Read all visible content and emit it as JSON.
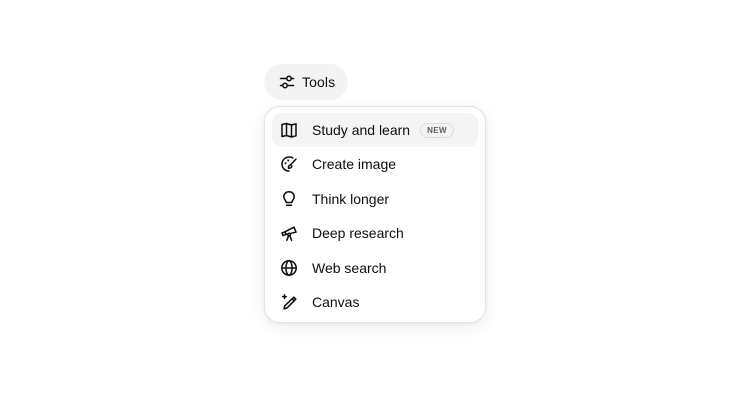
{
  "tools_button": {
    "label": "Tools",
    "icon": "sliders-icon"
  },
  "menu": {
    "items": [
      {
        "label": "Study and learn",
        "icon": "open-book-icon",
        "badge": "NEW",
        "highlighted": true
      },
      {
        "label": "Create image",
        "icon": "palette-brush-icon"
      },
      {
        "label": "Think longer",
        "icon": "lightbulb-icon"
      },
      {
        "label": "Deep research",
        "icon": "telescope-icon"
      },
      {
        "label": "Web search",
        "icon": "globe-icon"
      },
      {
        "label": "Canvas",
        "icon": "pencil-sparkle-icon"
      }
    ]
  },
  "colors": {
    "text": "#0d0d0d",
    "button_bg": "#f3f3f3",
    "hover_bg": "#f4f4f4",
    "border": "#e3e3e3"
  }
}
